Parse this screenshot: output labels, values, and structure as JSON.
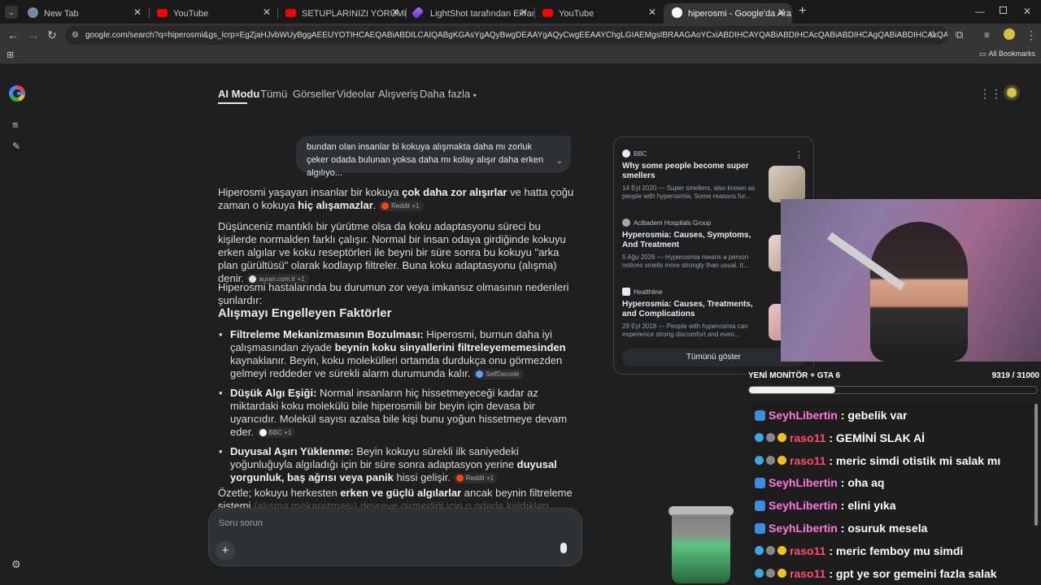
{
  "tabs": [
    {
      "title": "New Tab",
      "favicon": "chrome-icon"
    },
    {
      "title": "YouTube",
      "favicon": "youtube-icon"
    },
    {
      "title": "SETUPLARINIZI YORUMLUYORUM",
      "favicon": "youtube-icon"
    },
    {
      "title": "LightShot tarafından Ekran Görüntüsü",
      "favicon": "lightshot-icon"
    },
    {
      "title": "YouTube",
      "favicon": "youtube-icon"
    },
    {
      "title": "hiperosmi - Google'da Ara",
      "favicon": "google-icon",
      "active": true
    }
  ],
  "toolbar": {
    "url": "google.com/search?q=hiperosmi&gs_lcrp=EgZjaHJvbWUyBggAEEUYOTIHCAEQABiABDILCAIQABgKGAsYgAQyBwgDEAAYgAQyCwgEEAAYChgLGIAEMgsIBRAAGAoYCxiABDIHCAYQABiABDIHCAcQABiABDIHCAgQABiABDIHCAkQABiABNIBCDM0NjlqM...",
    "all_bookmarks": "All Bookmarks"
  },
  "search_nav": {
    "items": [
      "AI Modu",
      "Tümü",
      "Görseller",
      "Videolar",
      "Alışveriş",
      "Daha fazla"
    ]
  },
  "query_bubble": "bundan olan insanlar bi kokuya alışmakta daha mı zorluk çeker odada bulunan yoksa daha mı kolay alışır daha erken algılıyo...",
  "answer": {
    "p1_a": "Hiperosmi yaşayan insanlar bir kokuya ",
    "p1_b": "çok daha zor alışırlar",
    "p1_c": " ve hatta çoğu zaman o kokuya ",
    "p1_d": "hiç alışamazlar",
    "p1_e": ".",
    "p1_src": "Reddit +1",
    "p2": "Düşünceniz mantıklı bir yürütme olsa da koku adaptasyonu süreci bu kişilerde normalden farklı çalışır. Normal bir insan odaya girdiğinde kokuyu erken algılar ve koku reseptörleri ile beyni bir süre sonra bu kokuyu \"arka plan gürültüsü\" olarak kodlayıp filtreler. Buna koku adaptasyonu (alışma) denir.",
    "p2_src": "auran.com.tr +1",
    "p3": "Hiperosmi hastalarında bu durumun zor veya imkansız olmasının nedenleri şunlardır:",
    "heading": "Alışmayı Engelleyen Faktörler",
    "facts": [
      {
        "label": "Filtreleme Mekanizmasının Bozulması:",
        "t1": " Hiperosmi, burnun daha iyi çalışmasından ziyade ",
        "b2": "beynin koku sinyallerini filtreleyememesinden",
        "t2": " kaynaklanır. Beyin, koku molekülleri ortamda durdukça onu görmezden gelmeyi reddeder ve sürekli alarm durumunda kalır.",
        "src": "SelfDecode"
      },
      {
        "label": "Düşük Algı Eşiği:",
        "t1": " Normal insanların hiç hissetmeyeceği kadar az miktardaki koku molekülü bile hiperosmili bir beyin için devasa bir uyarıcıdır. Molekül sayısı azalsa bile kişi bunu yoğun hissetmeye devam eder.",
        "b2": "",
        "t2": "",
        "src": "BBC +1"
      },
      {
        "label": "Duyusal Aşırı Yüklenme:",
        "t1": " Beyin kokuyu sürekli ilk saniyedeki yoğunluğuyla algıladığı için bir süre sonra adaptasyon yerine ",
        "b2": "duyusal yorgunluk, baş ağrısı veya panik",
        "t2": " hissi gelişir.",
        "src": "Reddit +1"
      }
    ],
    "summary_a": "Özetle; kokuyu herkesten ",
    "summary_b": "erken ve güçlü algılarlar",
    "summary_c": " ancak beynin filtreleme sistemi",
    "summary_faded": "(alışma mekanizması) devreye girmediği için o odada kaldıkları sürece o kokuya maruz"
  },
  "sources": [
    {
      "site": "BBC",
      "title": "Why some people become super smellers",
      "desc": "14 Eyl 2020 — Super smellers, also known as people with hyperosmia, Some reasons for..."
    },
    {
      "site": "Acibadem Hospitals Group",
      "title": "Hyperosmia: Causes, Symptoms, And Treatment",
      "desc": "5 Ağu 2026 — Hyperosmia means a person notices smells more strongly than usual. It..."
    },
    {
      "site": "Healthline",
      "title": "Hyperosmia: Causes, Treatments, and Complications",
      "desc": "29 Eyl 2018 — People with hyperosmia can experience strong discomfort and even..."
    }
  ],
  "show_all": "Tümünü göster",
  "ask_placeholder": "Soru sorun",
  "stream": {
    "goal_label": "YENİ MONİTÖR + GTA 6",
    "goal_count": "9319 / 31000",
    "goal_progress": 0.3,
    "chat": [
      {
        "user": "SeyhLibertin",
        "msg": ": gebelik var",
        "color": "#ff77dd",
        "badges": "mod"
      },
      {
        "user": "raso11",
        "msg": ": GEMİNİ SLAK Aİ",
        "color": "#ff4a6e",
        "badges": "sub"
      },
      {
        "user": "raso11",
        "msg": ": meric simdi otistik mi salak mı",
        "color": "#ff4a6e",
        "badges": "sub"
      },
      {
        "user": "SeyhLibertin",
        "msg": ": oha aq",
        "color": "#ff77dd",
        "badges": "mod"
      },
      {
        "user": "SeyhLibertin",
        "msg": ": elini yıka",
        "color": "#ff77dd",
        "badges": "mod"
      },
      {
        "user": "SeyhLibertin",
        "msg": ": osuruk mesela",
        "color": "#ff77dd",
        "badges": "mod"
      },
      {
        "user": "raso11",
        "msg": ": meric femboy mu simdi",
        "color": "#ff4a6e",
        "badges": "sub"
      },
      {
        "user": "raso11",
        "msg": ": gpt ye sor gemeini fazla salak",
        "color": "#ff4a6e",
        "badges": "sub"
      }
    ]
  }
}
